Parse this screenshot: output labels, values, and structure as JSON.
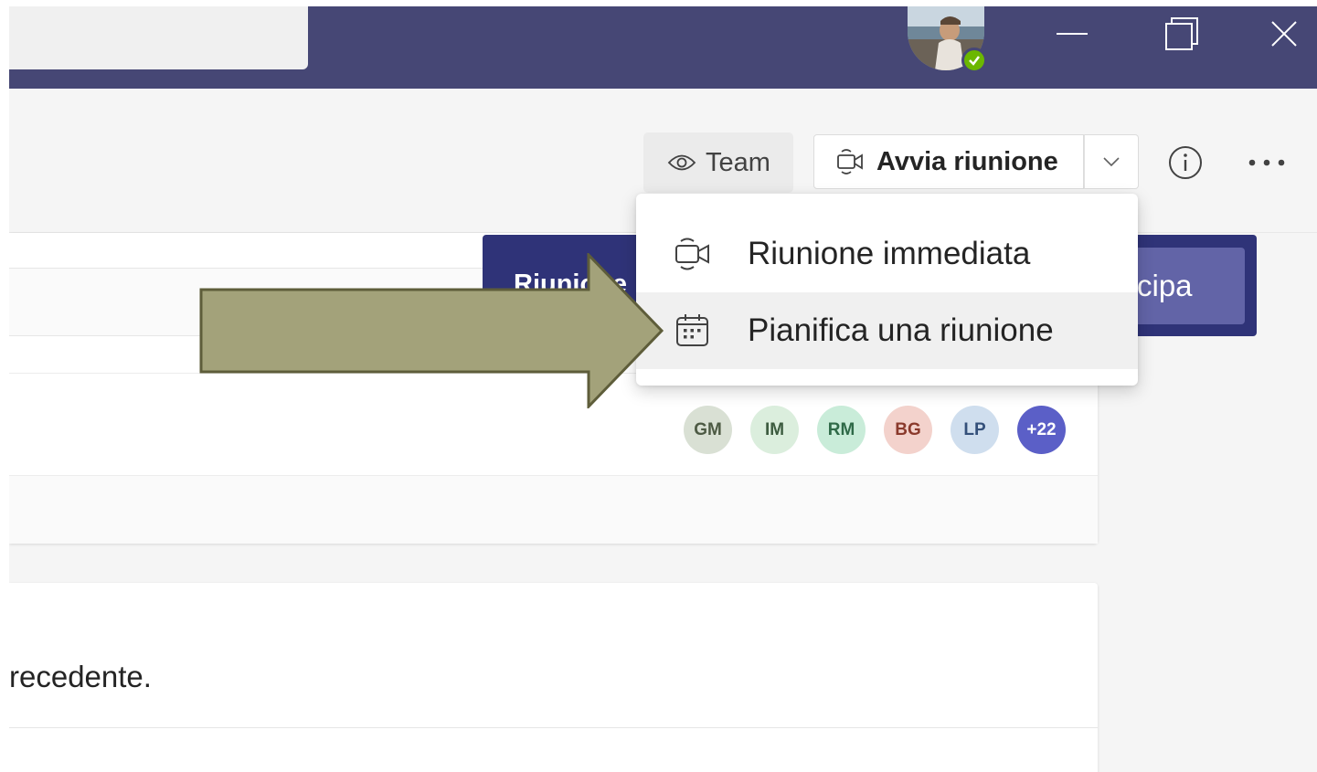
{
  "header": {
    "team_button_label": "Team",
    "start_meeting_label": "Avvia riunione"
  },
  "banner": {
    "label": "Riunione",
    "join_label": "cipa"
  },
  "menu": {
    "items": [
      {
        "label": "Riunione immediata",
        "icon": "video-camera-icon"
      },
      {
        "label": "Pianifica una riunione",
        "icon": "calendar-icon"
      }
    ]
  },
  "participants": [
    {
      "initials": "GM",
      "bg": "#d9e0d4",
      "fg": "#4d5a44"
    },
    {
      "initials": "IM",
      "bg": "#dbeedd",
      "fg": "#3d5c40"
    },
    {
      "initials": "RM",
      "bg": "#c9ecd9",
      "fg": "#2f6a48"
    },
    {
      "initials": "BG",
      "bg": "#f3d2cc",
      "fg": "#8a3a2c"
    },
    {
      "initials": "LP",
      "bg": "#cfdeee",
      "fg": "#34507a"
    },
    {
      "initials": "+22",
      "bg": "#5b5fc7",
      "fg": "#ffffff"
    }
  ],
  "post": {
    "text": "recedente."
  },
  "colors": {
    "titlebar": "#464775",
    "accent": "#6264a7",
    "arrow_fill": "#a3a27a",
    "arrow_stroke": "#5e5d3a"
  }
}
